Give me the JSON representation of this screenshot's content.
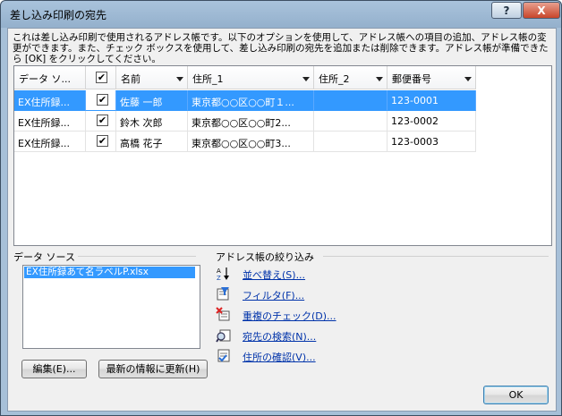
{
  "window": {
    "title": "差し込み印刷の宛先"
  },
  "title_buttons": {
    "help": "?",
    "close": "X"
  },
  "description": "これは差し込み印刷で使用されるアドレス帳です。以下のオプションを使用して、アドレス帳への項目の追加、アドレス帳の変更ができます。また、チェック ボックスを使用して、差し込み印刷の宛先を追加または削除できます。アドレス帳が準備できたら [OK] をクリックしてください。",
  "table": {
    "columns": [
      "データ ソ...",
      "",
      "名前",
      "住所_1",
      "住所_2",
      "郵便番号"
    ],
    "rows": [
      {
        "source": "EX住所録...",
        "checked": "✔",
        "name": "佐藤 一郎",
        "addr1": "東京都○○区○○町１...",
        "addr2": "",
        "zip": "123-0001"
      },
      {
        "source": "EX住所録...",
        "checked": "✔",
        "name": "鈴木 次郎",
        "addr1": "東京都○○区○○町2...",
        "addr2": "",
        "zip": "123-0002"
      },
      {
        "source": "EX住所録...",
        "checked": "✔",
        "name": "高橋 花子",
        "addr1": "東京都○○区○○町3...",
        "addr2": "",
        "zip": "123-0003"
      }
    ],
    "selected_row": 0,
    "header_check": "✔"
  },
  "datasource": {
    "label": "データ ソース",
    "items": [
      "EX住所録あて名ラベルP.xlsx"
    ],
    "edit_button": "編集(E)...",
    "refresh_button": "最新の情報に更新(H)"
  },
  "refine": {
    "label": "アドレス帳の絞り込み",
    "links": [
      {
        "label": "並べ替え(S)...",
        "icon": "sort-az-icon"
      },
      {
        "label": "フィルタ(F)...",
        "icon": "filter-icon"
      },
      {
        "label": "重複のチェック(D)...",
        "icon": "duplicate-check-icon"
      },
      {
        "label": "宛先の検索(N)...",
        "icon": "find-recipient-icon"
      },
      {
        "label": "住所の確認(V)...",
        "icon": "validate-address-icon"
      }
    ]
  },
  "footer": {
    "ok_button": "OK"
  },
  "colors": {
    "selection": "#3399ff",
    "link": "#0033aa",
    "chrome": "#a7c0d8"
  }
}
